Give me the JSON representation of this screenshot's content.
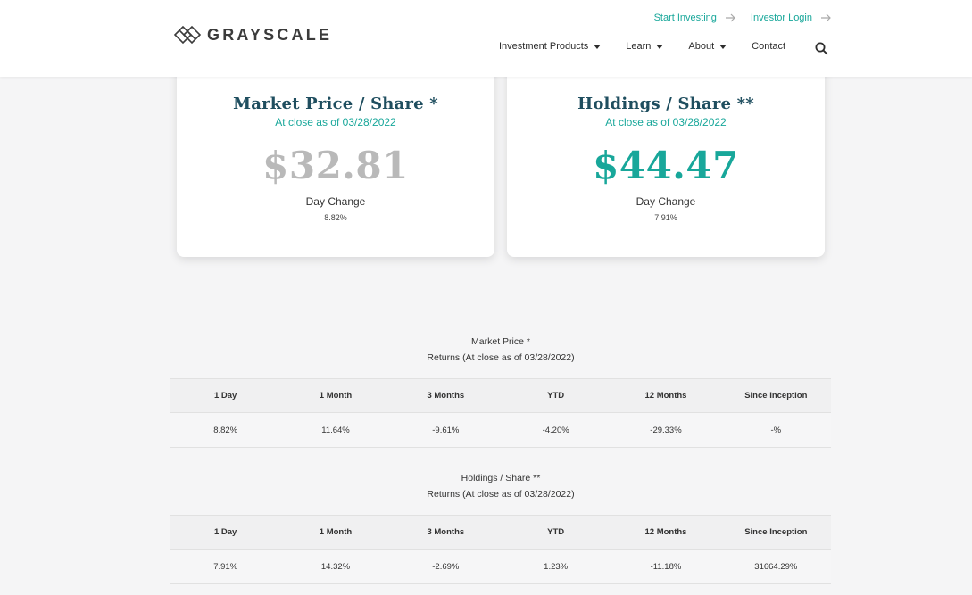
{
  "header": {
    "logo_text": "GRAYSCALE",
    "top_links": [
      {
        "label": "Start Investing"
      },
      {
        "label": "Investor Login"
      }
    ],
    "nav": [
      {
        "label": "Investment Products",
        "dropdown": true
      },
      {
        "label": "Learn",
        "dropdown": true
      },
      {
        "label": "About",
        "dropdown": true
      },
      {
        "label": "Contact",
        "dropdown": false
      }
    ]
  },
  "cards": {
    "market": {
      "title": "Market Price / Share *",
      "subtitle": "At close as of 03/28/2022",
      "value": "$32.81",
      "change_label": "Day Change",
      "change": "8.82%"
    },
    "holdings": {
      "title": "Holdings / Share **",
      "subtitle": "At close as of 03/28/2022",
      "value": "$44.47",
      "change_label": "Day Change",
      "change": "7.91%"
    }
  },
  "returns": {
    "columns": [
      "1 Day",
      "1 Month",
      "3 Months",
      "YTD",
      "12 Months",
      "Since Inception"
    ],
    "market": {
      "title": "Market Price *",
      "subtitle": "Returns (At close as of 03/28/2022)",
      "values": [
        "8.82%",
        "11.64%",
        "-9.61%",
        "-4.20%",
        "-29.33%",
        "-%"
      ]
    },
    "holdings": {
      "title": "Holdings / Share **",
      "subtitle": "Returns (At close as of 03/28/2022)",
      "values": [
        "7.91%",
        "14.32%",
        "-2.69%",
        "1.23%",
        "-11.18%",
        "31664.29%"
      ]
    }
  },
  "colors": {
    "accent": "#18a79a",
    "title": "#1f4e5f",
    "muted_value": "#b9b9b9"
  }
}
